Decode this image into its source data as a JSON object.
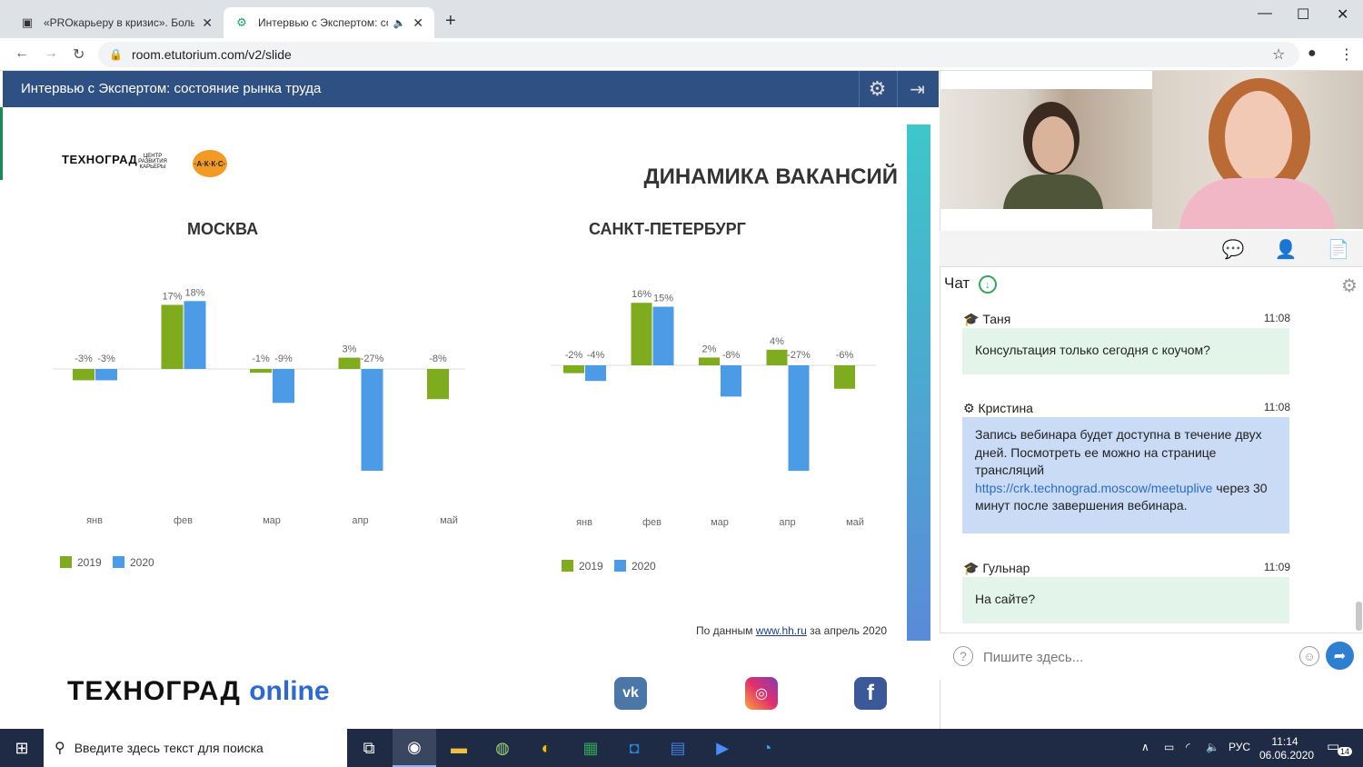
{
  "browser": {
    "tabs": [
      {
        "title": "«PROкарьеру в кризис». Большие",
        "active": false
      },
      {
        "title": "Интервью с Экспертом: сос",
        "active": true
      }
    ],
    "url": "room.etutorium.com/v2/slide"
  },
  "slide": {
    "header_title": "Интервью с Экспертом: состояние рынка труда",
    "logo_text": "ТЕХНОГРАД",
    "logo_center": "ЦЕНТР РАЗВИТИЯ КАРЬЕРЫ",
    "logo_akks": "·А·К·К·С·",
    "heading": "ДИНАМИКА ВАКАНСИЙ",
    "source_prefix": "По данным ",
    "source_link": "www.hh.ru",
    "source_suffix": " за апрель 2020",
    "brand_main": "ТЕХНОГРАД",
    "brand_online": "online",
    "social": {
      "vk": "vk",
      "ig": "instagram",
      "fb": "f"
    }
  },
  "chart_data": [
    {
      "type": "bar",
      "title": "МОСКВА",
      "categories": [
        "янв",
        "фев",
        "мар",
        "апр",
        "май"
      ],
      "series": [
        {
          "name": "2019",
          "values": [
            -3,
            17,
            -1,
            3,
            -8
          ],
          "labels": [
            "-3%",
            "17%",
            "-1%",
            "3%",
            "-8%"
          ],
          "color": "#7fab1f"
        },
        {
          "name": "2020",
          "values": [
            -3,
            18,
            -9,
            -27,
            null
          ],
          "labels": [
            "-3%",
            "18%",
            "-9%",
            "-27%",
            ""
          ],
          "color": "#4c9be6"
        }
      ]
    },
    {
      "type": "bar",
      "title": "САНКТ-ПЕТЕРБУРГ",
      "categories": [
        "янв",
        "фев",
        "мар",
        "апр",
        "май"
      ],
      "series": [
        {
          "name": "2019",
          "values": [
            -2,
            16,
            2,
            4,
            -6
          ],
          "labels": [
            "-2%",
            "16%",
            "2%",
            "4%",
            "-6%"
          ],
          "color": "#7fab1f"
        },
        {
          "name": "2020",
          "values": [
            -4,
            15,
            -8,
            -27,
            null
          ],
          "labels": [
            "-4%",
            "15%",
            "-8%",
            "-27%",
            ""
          ],
          "color": "#4c9be6"
        }
      ]
    }
  ],
  "panel": {
    "chat_title": "Чат",
    "messages": [
      {
        "author": "Таня",
        "time": "11:08",
        "text": "Консультация только сегодня с коучом?",
        "style": "green"
      },
      {
        "author": "Кристина",
        "time": "11:08",
        "text_before": "Запись вебинара будет доступна в течение двух дней. Посмотреть ее можно на странице трансляций ",
        "link": "https://crk.technograd.moscow/meetuplive",
        "text_after": " через 30 минут после завершения вебинара.",
        "style": "blue"
      },
      {
        "author": "Гульнар",
        "time": "11:09",
        "text": "На сайте?",
        "style": "green"
      }
    ],
    "input_placeholder": "Пишите здесь..."
  },
  "taskbar": {
    "search_placeholder": "Введите здесь текст для поиска",
    "lang": "РУС",
    "time": "11:14",
    "date": "06.06.2020",
    "notifications": "14"
  }
}
